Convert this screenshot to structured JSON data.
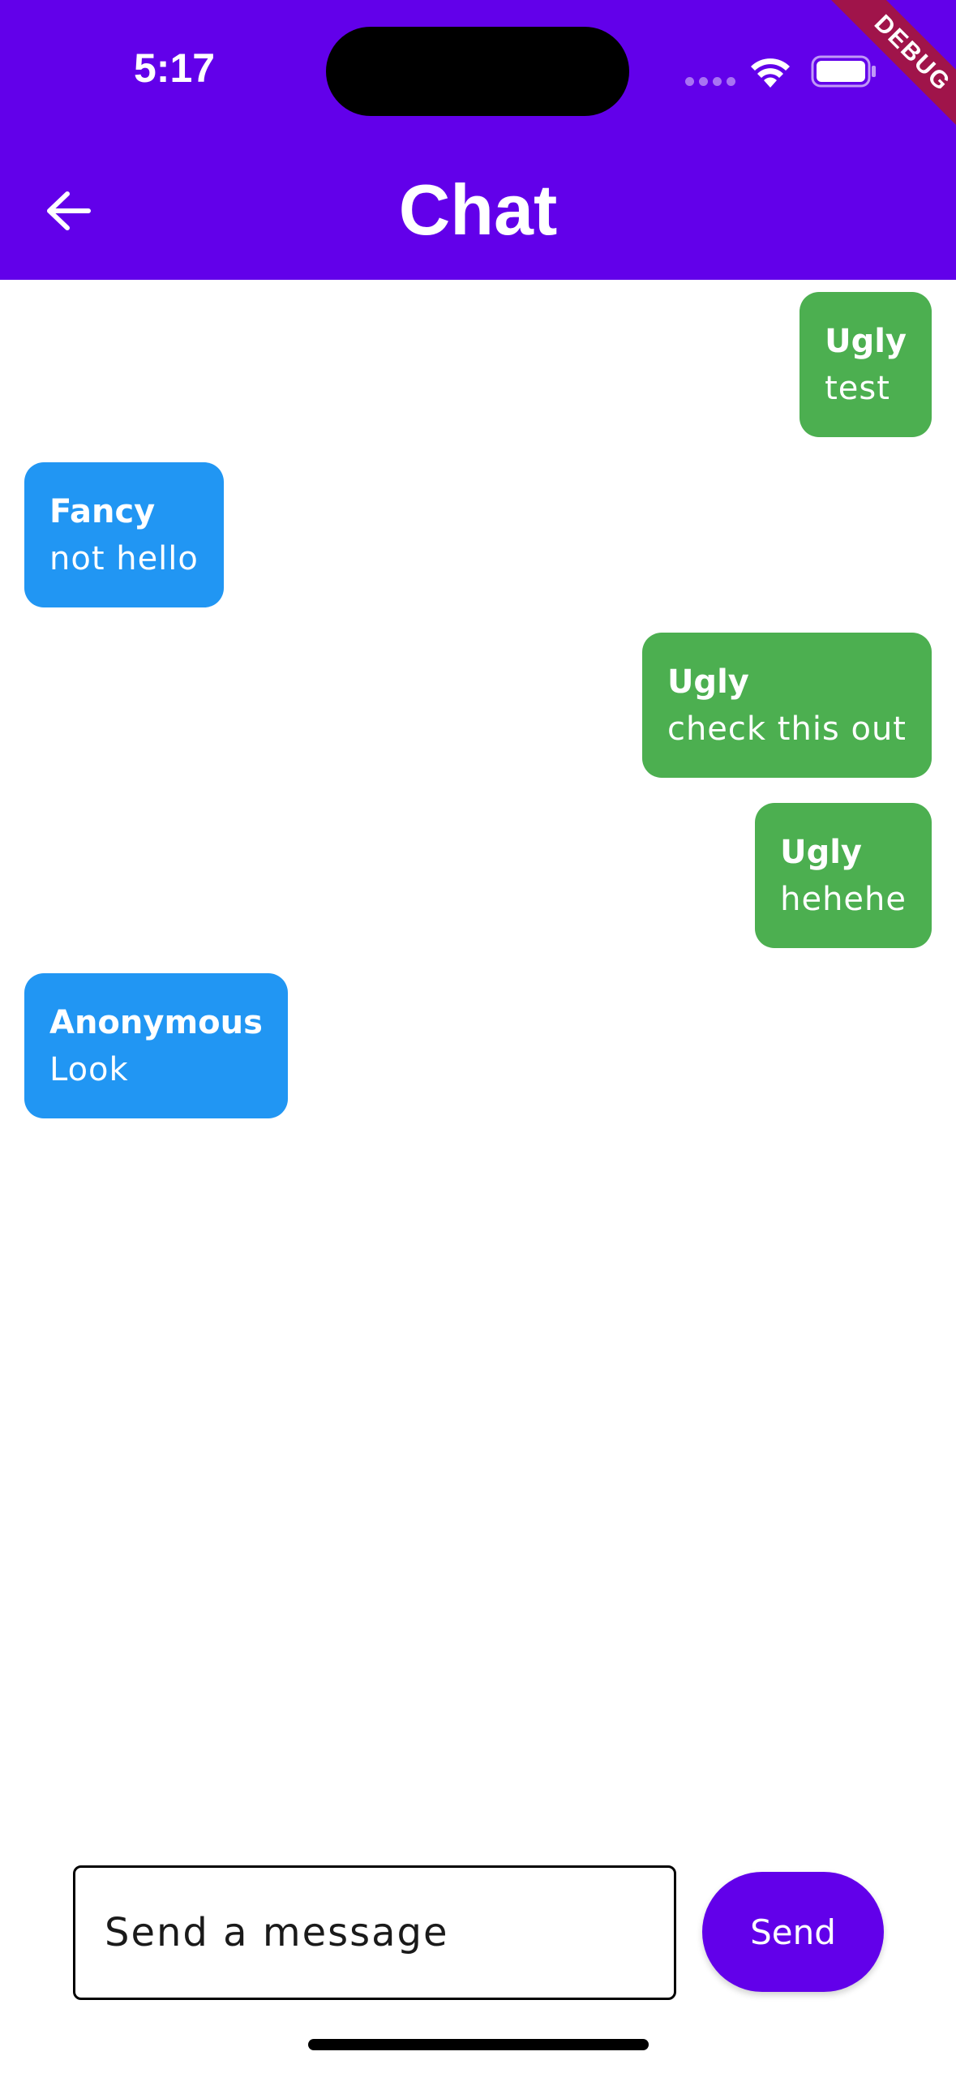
{
  "status_bar": {
    "time": "5:17"
  },
  "debug_banner": "DEBUG",
  "header": {
    "title": "Chat",
    "back_icon": "arrow-left-icon"
  },
  "messages": [
    {
      "sender": "Ugly",
      "text": "test",
      "side": "right",
      "color": "#4CAF50"
    },
    {
      "sender": "Fancy",
      "text": "not hello",
      "side": "left",
      "color": "#2196F3"
    },
    {
      "sender": "Ugly",
      "text": "check this out",
      "side": "right",
      "color": "#4CAF50"
    },
    {
      "sender": "Ugly",
      "text": "hehehe",
      "side": "right",
      "color": "#4CAF50"
    },
    {
      "sender": "Anonymous",
      "text": "Look",
      "side": "left",
      "color": "#2196F3"
    }
  ],
  "composer": {
    "placeholder": "Send a message",
    "value": "",
    "send_label": "Send"
  },
  "colors": {
    "accent": "#6200EA",
    "own_bubble": "#4CAF50",
    "other_bubble": "#2196F3",
    "debug": "#A0144A"
  }
}
